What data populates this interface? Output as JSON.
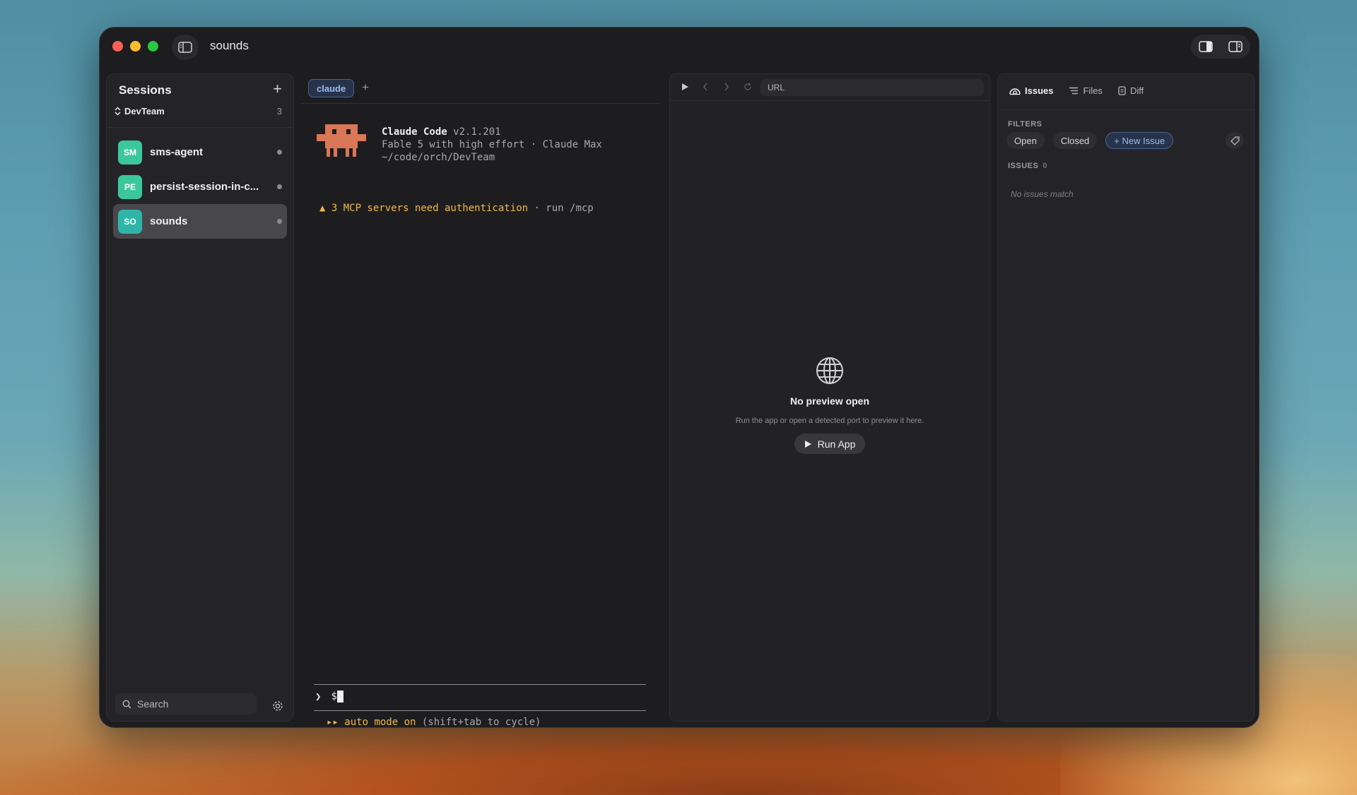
{
  "window": {
    "title": "sounds"
  },
  "sidebar": {
    "title": "Sessions",
    "team": "DevTeam",
    "count": "3",
    "sessions": [
      {
        "initials": "SM",
        "name": "sms-agent",
        "color": "#3cc79a"
      },
      {
        "initials": "PE",
        "name": "persist-session-in-c...",
        "color": "#3cc79a"
      },
      {
        "initials": "SO",
        "name": "sounds",
        "color": "#2fb5a8"
      }
    ],
    "search_placeholder": "Search"
  },
  "terminal": {
    "tab_label": "claude",
    "product": "Claude Code",
    "version": "v2.1.201",
    "model_line": "Fable 5 with high effort · Claude Max",
    "path": "~/code/orch/DevTeam",
    "warning": "▲ 3 MCP servers need authentication",
    "warning_suffix": " · run /mcp",
    "prompt_symbol": "❯",
    "prompt_text": "$",
    "automode_arrows": "▸▸",
    "automode_label": "auto mode on",
    "automode_hint": " (shift+tab to cycle)"
  },
  "preview": {
    "url_placeholder": "URL",
    "empty_title": "No preview open",
    "empty_subtitle": "Run the app or open a detected port to preview it here.",
    "run_button": "Run App"
  },
  "issues_panel": {
    "tabs": [
      "Issues",
      "Files",
      "Diff"
    ],
    "filters_label": "FILTERS",
    "filter_open": "Open",
    "filter_closed": "Closed",
    "new_issue": "+ New Issue",
    "issues_label": "ISSUES",
    "issues_count": "0",
    "empty": "No issues match"
  },
  "colors": {
    "accent": "#9cbcf0",
    "warning": "#f2b84b",
    "claude_orange": "#d97757"
  }
}
